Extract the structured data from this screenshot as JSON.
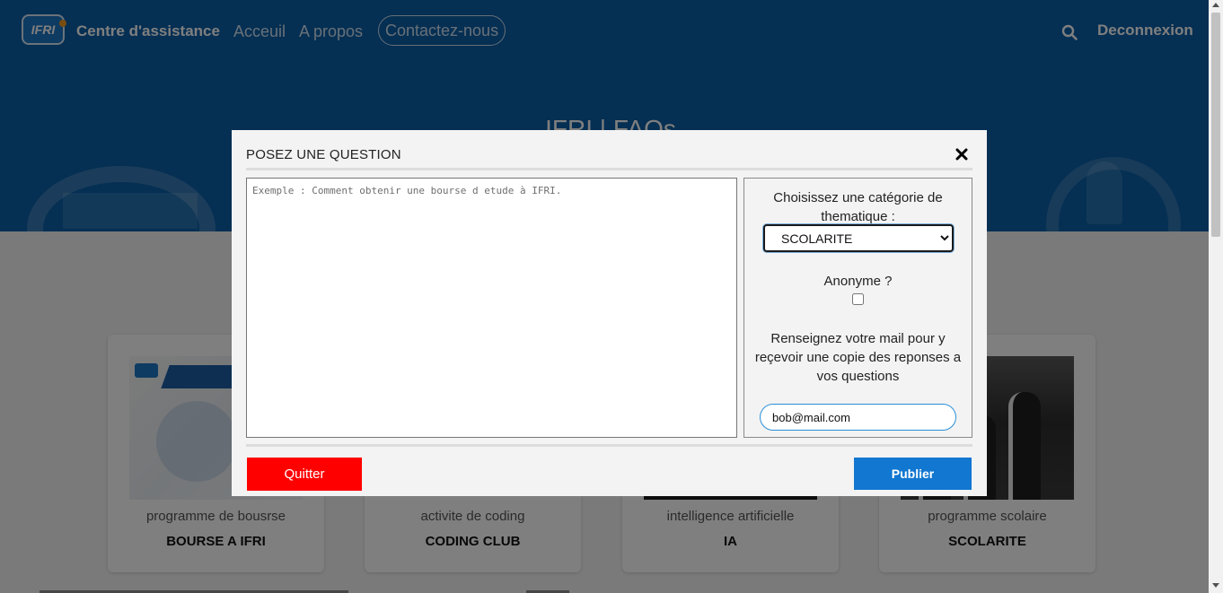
{
  "navbar": {
    "logo_text": "IFRI",
    "brand": "Centre d'assistance",
    "links": [
      {
        "label": "Acceuil"
      },
      {
        "label": "A propos"
      },
      {
        "label": "Contactez-nous"
      }
    ],
    "logout_label": "Deconnexion"
  },
  "hero": {
    "title": "IFRI | FAQs"
  },
  "cards": [
    {
      "subtitle": "programme de bousrse",
      "title": "BOURSE A IFRI"
    },
    {
      "subtitle": "activite de coding",
      "title": "CODING CLUB"
    },
    {
      "subtitle": "intelligence artificielle",
      "title": "IA"
    },
    {
      "subtitle": "programme scolaire",
      "title": "SCOLARITE"
    }
  ],
  "modal": {
    "title": "POSEZ UNE QUESTION",
    "question_placeholder": "Exemple : Comment obtenir une bourse d etude à IFRI.",
    "category_label": "Choisissez une catégorie de thematique :",
    "category_selected": "SCOLARITE",
    "anonymous_label": "Anonyme ?",
    "anonymous_checked": false,
    "mail_label": "Renseignez votre mail pour y reçevoir une copie des reponses a vos questions",
    "mail_value": "bob@mail.com",
    "quit_label": "Quitter",
    "publish_label": "Publier"
  },
  "colors": {
    "hero_blue": "#0a5fa6",
    "quit_red": "#ff0000",
    "publish_blue": "#1177d1"
  }
}
